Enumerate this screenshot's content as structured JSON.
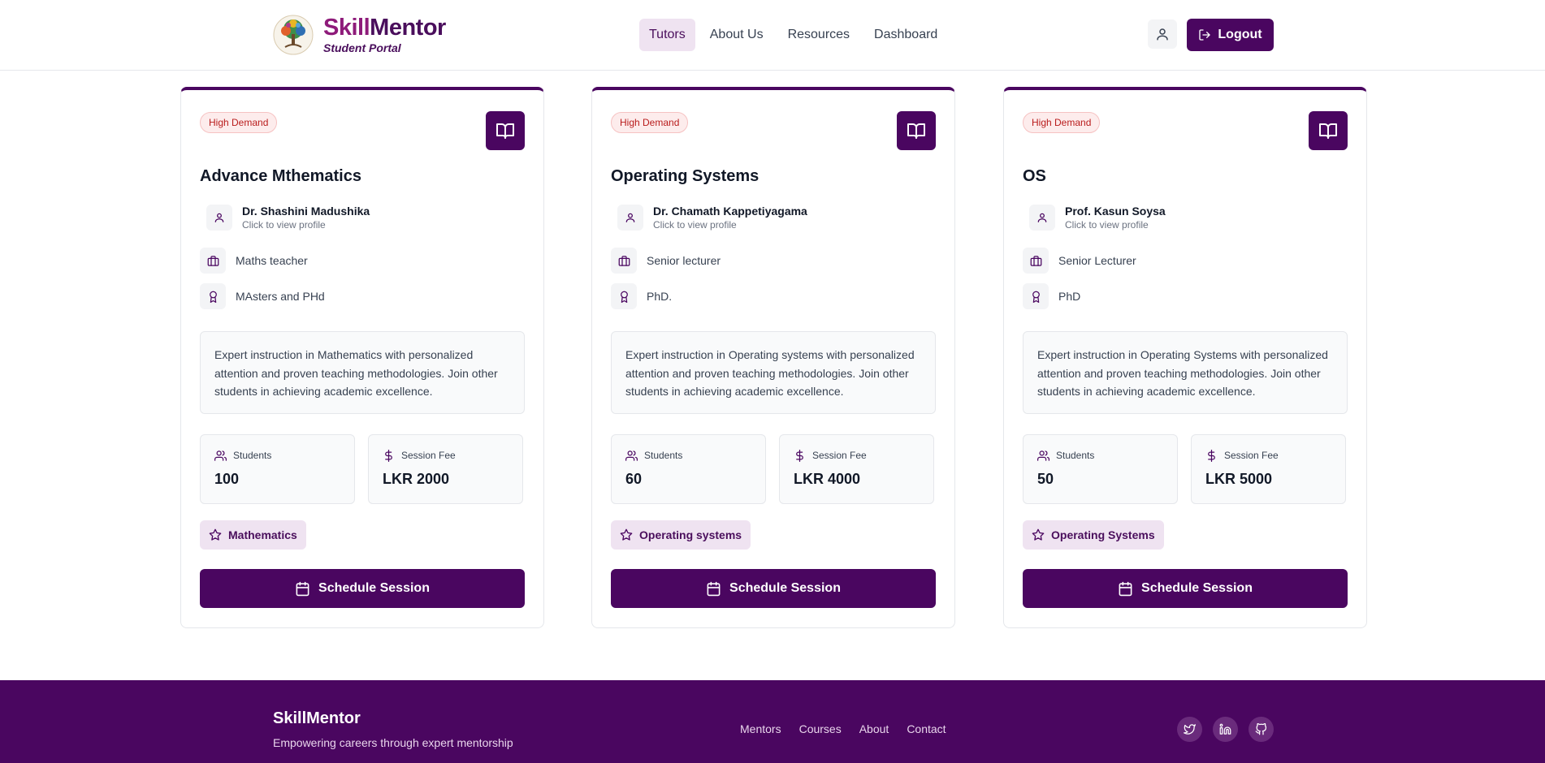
{
  "header": {
    "brand_part1": "Skill",
    "brand_part2": "Mentor",
    "subtitle": "Student Portal",
    "nav": [
      "Tutors",
      "About Us",
      "Resources",
      "Dashboard"
    ],
    "active_nav": "Tutors",
    "logout_label": "Logout"
  },
  "labels": {
    "students": "Students",
    "session_fee": "Session Fee",
    "schedule": "Schedule Session",
    "profile_hint": "Click to view profile"
  },
  "courses": [
    {
      "badge": "High Demand",
      "title": "Advance Mthematics",
      "mentor": "Dr. Shashini Madushika",
      "position": "Maths teacher",
      "qualification": "MAsters and PHd",
      "description": "Expert instruction in Mathematics with personalized attention and proven teaching methodologies. Join other students in achieving academic excellence.",
      "students": "100",
      "fee": "LKR 2000",
      "subject": "Mathematics"
    },
    {
      "badge": "High Demand",
      "title": "Operating Systems",
      "mentor": "Dr. Chamath Kappetiyagama",
      "position": "Senior lecturer",
      "qualification": "PhD.",
      "description": "Expert instruction in Operating systems with personalized attention and proven teaching methodologies. Join other students in achieving academic excellence.",
      "students": "60",
      "fee": "LKR 4000",
      "subject": "Operating systems"
    },
    {
      "badge": "High Demand",
      "title": "OS",
      "mentor": "Prof. Kasun Soysa",
      "position": "Senior Lecturer",
      "qualification": "PhD",
      "description": "Expert instruction in Operating Systems with personalized attention and proven teaching methodologies. Join other students in achieving academic excellence.",
      "students": "50",
      "fee": "LKR 5000",
      "subject": "Operating Systems"
    }
  ],
  "footer": {
    "brand": "SkillMentor",
    "tagline": "Empowering careers through expert mentorship",
    "links": [
      "Mentors",
      "Courses",
      "About",
      "Contact"
    ],
    "socials": [
      "twitter-icon",
      "linkedin-icon",
      "github-icon"
    ]
  },
  "colors": {
    "primary": "#4a0660",
    "accent": "#8e1b7a",
    "badge_bg": "#fdecec",
    "badge_text": "#b91c1c",
    "tag_bg": "#efe3f1"
  }
}
